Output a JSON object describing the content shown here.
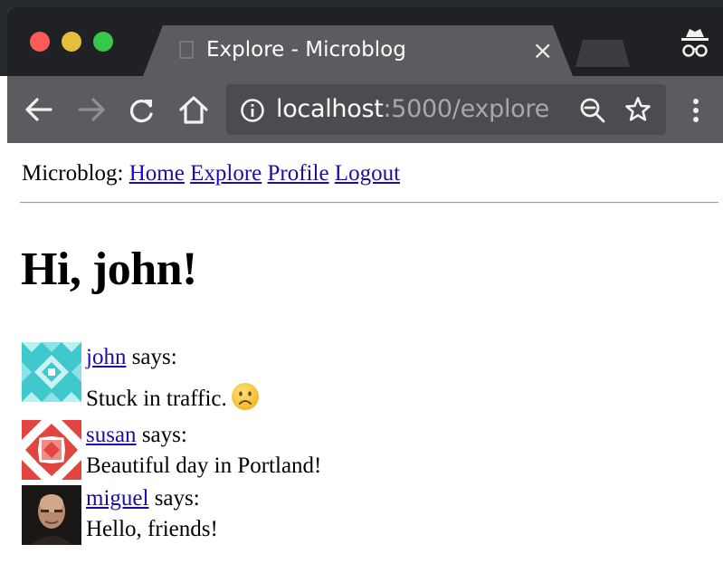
{
  "browser": {
    "tab_title": "Explore - Microblog",
    "tab_close": "×",
    "url_host": "localhost",
    "url_rest": ":5000/explore"
  },
  "icons": {
    "back": "arrow-left-icon",
    "forward": "arrow-right-icon",
    "reload": "reload-icon",
    "home": "home-icon",
    "info": "info-icon",
    "zoom": "zoom-icon",
    "star": "star-icon",
    "menu": "kebab-menu-icon",
    "incognito": "incognito-icon"
  },
  "nav": {
    "brand": "Microblog:",
    "links": [
      "Home",
      "Explore",
      "Profile",
      "Logout"
    ]
  },
  "greeting": "Hi, john!",
  "posts": [
    {
      "author": "john",
      "says": "says:",
      "body": "Stuck in traffic.",
      "avatar_color": "#3fc9cc"
    },
    {
      "author": "susan",
      "says": "says:",
      "body": "Beautiful day in Portland!",
      "avatar_color": "#e2453f"
    },
    {
      "author": "miguel",
      "says": "says:",
      "body": "Hello, friends!",
      "avatar_color": "#3a2a24"
    }
  ],
  "colors": {
    "link": "#1a0dab",
    "chrome_dark": "#202124",
    "chrome_toolbar": "#5a5c5f"
  }
}
